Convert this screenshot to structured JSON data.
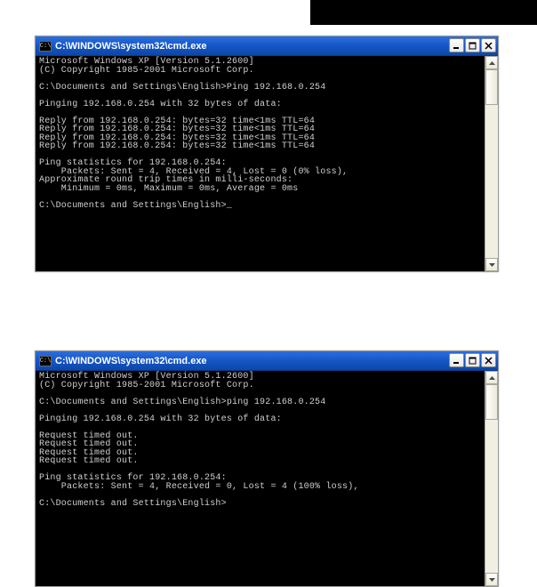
{
  "window1": {
    "title": "C:\\WINDOWS\\system32\\cmd.exe",
    "icon": "cmd-icon",
    "lines": [
      "Microsoft Windows XP [Version 5.1.2600]",
      "(C) Copyright 1985-2001 Microsoft Corp.",
      "",
      "C:\\Documents and Settings\\English>Ping 192.168.0.254",
      "",
      "Pinging 192.168.0.254 with 32 bytes of data:",
      "",
      "Reply from 192.168.0.254: bytes=32 time<1ms TTL=64",
      "Reply from 192.168.0.254: bytes=32 time<1ms TTL=64",
      "Reply from 192.168.0.254: bytes=32 time<1ms TTL=64",
      "Reply from 192.168.0.254: bytes=32 time<1ms TTL=64",
      "",
      "Ping statistics for 192.168.0.254:",
      "    Packets: Sent = 4, Received = 4, Lost = 0 (0% loss),",
      "Approximate round trip times in milli-seconds:",
      "    Minimum = 0ms, Maximum = 0ms, Average = 0ms",
      "",
      "C:\\Documents and Settings\\English>_"
    ]
  },
  "window2": {
    "title": "C:\\WINDOWS\\system32\\cmd.exe",
    "icon": "cmd-icon",
    "lines": [
      "Microsoft Windows XP [Version 5.1.2600]",
      "(C) Copyright 1985-2001 Microsoft Corp.",
      "",
      "C:\\Documents and Settings\\English>ping 192.168.0.254",
      "",
      "Pinging 192.168.0.254 with 32 bytes of data:",
      "",
      "Request timed out.",
      "Request timed out.",
      "Request timed out.",
      "Request timed out.",
      "",
      "Ping statistics for 192.168.0.254:",
      "    Packets: Sent = 4, Received = 0, Lost = 4 (100% loss),",
      "",
      "C:\\Documents and Settings\\English>"
    ]
  },
  "controls": {
    "minimize": "_",
    "maximize": "□",
    "close": "×"
  }
}
